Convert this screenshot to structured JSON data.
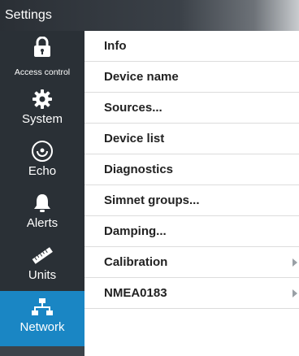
{
  "window": {
    "title": "Settings"
  },
  "sidebar": {
    "items": [
      {
        "label": "Access control",
        "icon": "lock-icon"
      },
      {
        "label": "System",
        "icon": "gear-icon"
      },
      {
        "label": "Echo",
        "icon": "sonar-icon"
      },
      {
        "label": "Alerts",
        "icon": "bell-icon"
      },
      {
        "label": "Units",
        "icon": "ruler-icon"
      },
      {
        "label": "Network",
        "icon": "network-icon",
        "active": true
      }
    ]
  },
  "menu": {
    "items": [
      {
        "label": "Info"
      },
      {
        "label": "Device name"
      },
      {
        "label": "Sources..."
      },
      {
        "label": "Device list"
      },
      {
        "label": "Diagnostics"
      },
      {
        "label": "Simnet groups..."
      },
      {
        "label": "Damping..."
      },
      {
        "label": "Calibration",
        "has_submenu": true
      },
      {
        "label": "NMEA0183",
        "has_submenu": true
      }
    ]
  },
  "colors": {
    "accent": "#1a86c4",
    "sidebar": "#2a3036"
  }
}
